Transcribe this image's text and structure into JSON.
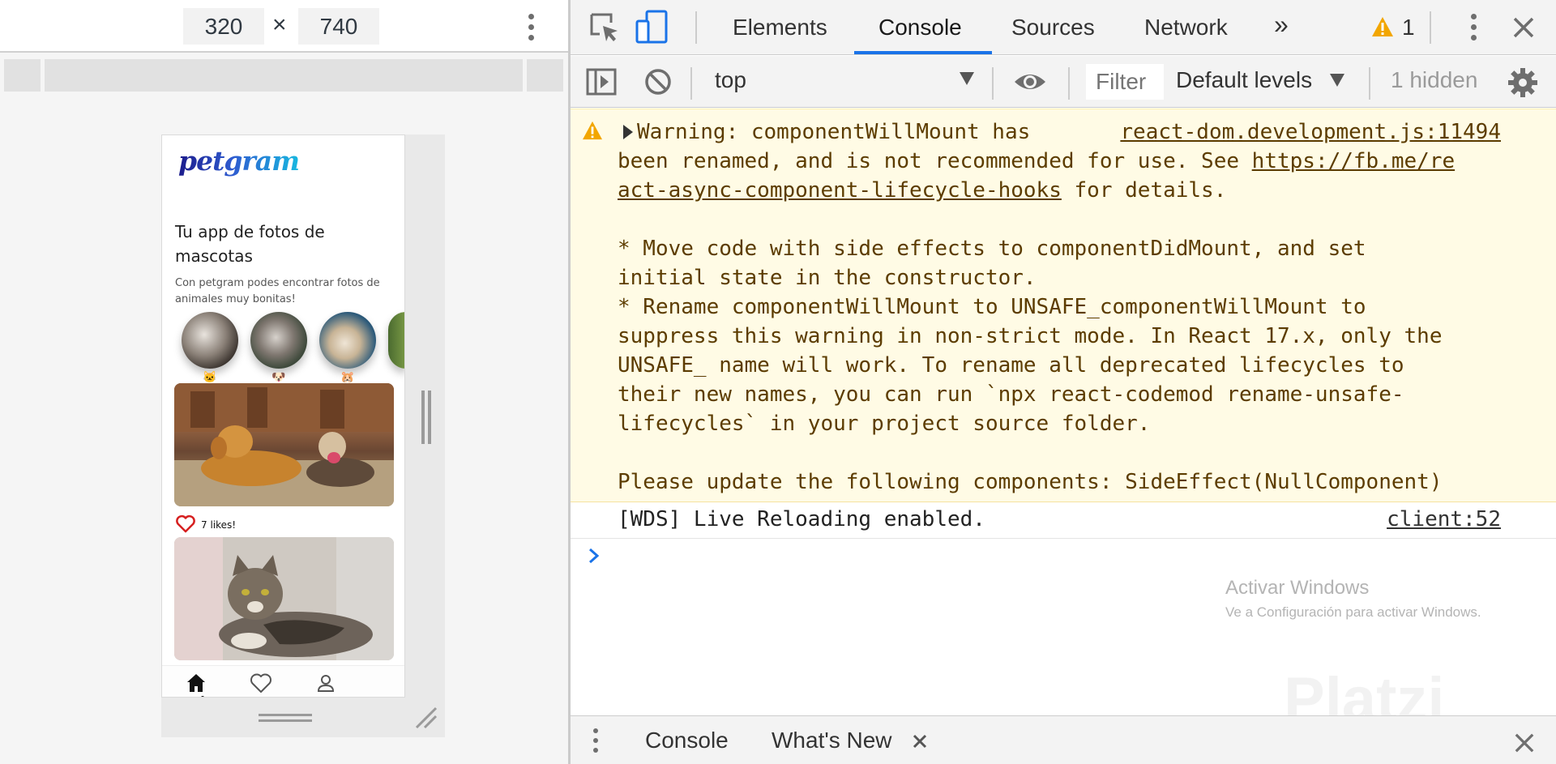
{
  "device_toolbar": {
    "width_value": "320",
    "times_symbol": "×",
    "height_value": "740",
    "more_icon": "kebab-vertical-icon"
  },
  "app": {
    "logo": "petgram",
    "title": "Tu app de fotos de mascotas",
    "description": "Con petgram podes encontrar fotos de animales muy bonitas!",
    "categories": [
      {
        "emoji": "🐱"
      },
      {
        "emoji": "🐶"
      },
      {
        "emoji": "🐹"
      }
    ],
    "likes_text": "7 likes!",
    "nav": [
      "home-icon",
      "heart-icon",
      "user-icon"
    ]
  },
  "devtools": {
    "tabs": [
      "Elements",
      "Console",
      "Sources",
      "Network"
    ],
    "active_tab": "Console",
    "more_tabs": "»",
    "warning_count": "1",
    "filterbar": {
      "context": "top",
      "filter_placeholder": "Filter",
      "levels": "Default levels",
      "hidden": "1 hidden"
    },
    "console": {
      "warning_source": "react-dom.development.js:11494",
      "warning_line1": "Warning: componentWillMount has",
      "warning_line2_pre": "been renamed, and is not recommended for use. See ",
      "warning_link": "https://fb.me/react-async-component-lifecycle-hooks",
      "warning_link_part1": "https://fb.me/re",
      "warning_link_part2": "act-async-component-lifecycle-hooks",
      "warning_after_link": " for details.",
      "warning_body": "* Move code with side effects to componentDidMount, and set\ninitial state in the constructor.\n* Rename componentWillMount to UNSAFE_componentWillMount to\nsuppress this warning in non-strict mode. In React 17.x, only the\nUNSAFE_ name will work. To rename all deprecated lifecycles to\ntheir new names, you can run `npx react-codemod rename-unsafe-\nlifecycles` in your project source folder.",
      "warning_footer": "Please update the following components: SideEffect(NullComponent)",
      "wds_message": "[WDS] Live Reloading enabled.",
      "wds_source": "client:52"
    },
    "drawer_tabs": [
      "Console",
      "What's New"
    ],
    "accent_color": "#1a73e8",
    "warning_bg": "#fffbe5"
  },
  "watermark": {
    "line1": "Activar Windows",
    "line2": "Ve a Configuración para activar Windows.",
    "brand": "Platzi"
  }
}
